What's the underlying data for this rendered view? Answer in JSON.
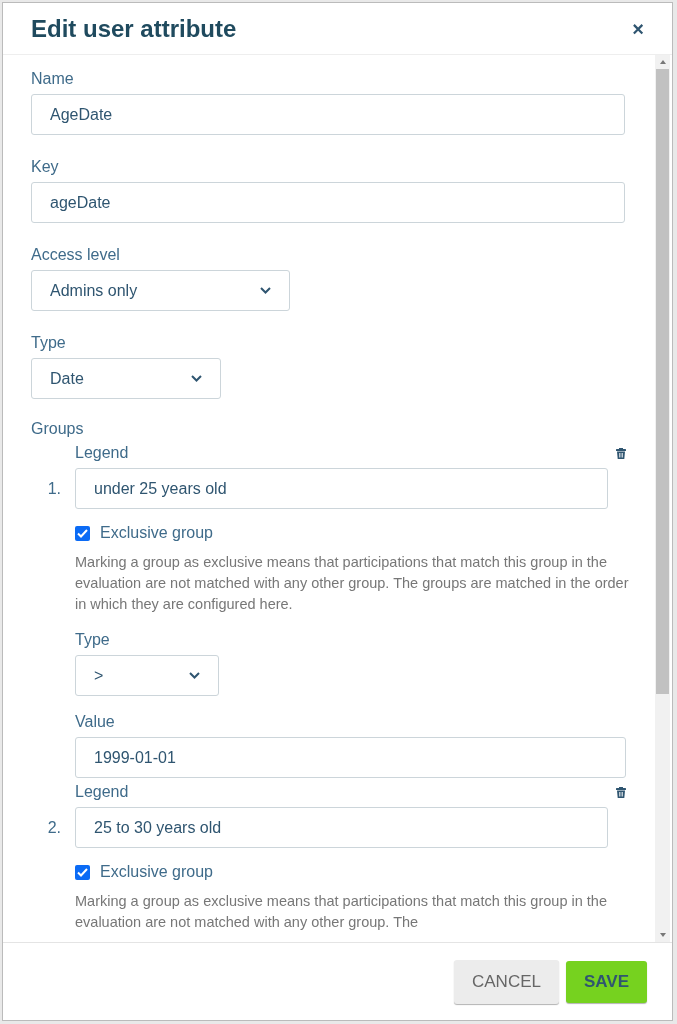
{
  "dialog": {
    "title": "Edit user attribute",
    "close": "×"
  },
  "fields": [
    {
      "kind": "input",
      "label": "Name",
      "value": "AgeDate"
    },
    {
      "kind": "input",
      "label": "Key",
      "value": "ageDate"
    },
    {
      "kind": "select",
      "label": "Access level",
      "value": "Admins only"
    },
    {
      "kind": "select",
      "label": "Type",
      "value": "Date"
    }
  ],
  "groups": {
    "label": "Groups",
    "items": [
      {
        "number": "1.",
        "legend_label": "Legend",
        "legend": "under 25 years old",
        "exclusive_label": "Exclusive group",
        "exclusive": true,
        "help": "Marking a group as exclusive means that participations that match this group in the evaluation are not matched with any other group. The groups are matched in the order in which they are configured here.",
        "type_label": "Type",
        "type": ">",
        "value_label": "Value",
        "value": "1999-01-01"
      },
      {
        "number": "2.",
        "legend_label": "Legend",
        "legend": "25 to 30 years old",
        "exclusive_label": "Exclusive group",
        "exclusive": true,
        "help": "Marking a group as exclusive means that participations that match this group in the evaluation are not matched with any other group. The"
      }
    ]
  },
  "buttons": [
    {
      "kind": "secondary",
      "label": "CANCEL"
    },
    {
      "kind": "primary",
      "label": "SAVE"
    }
  ]
}
